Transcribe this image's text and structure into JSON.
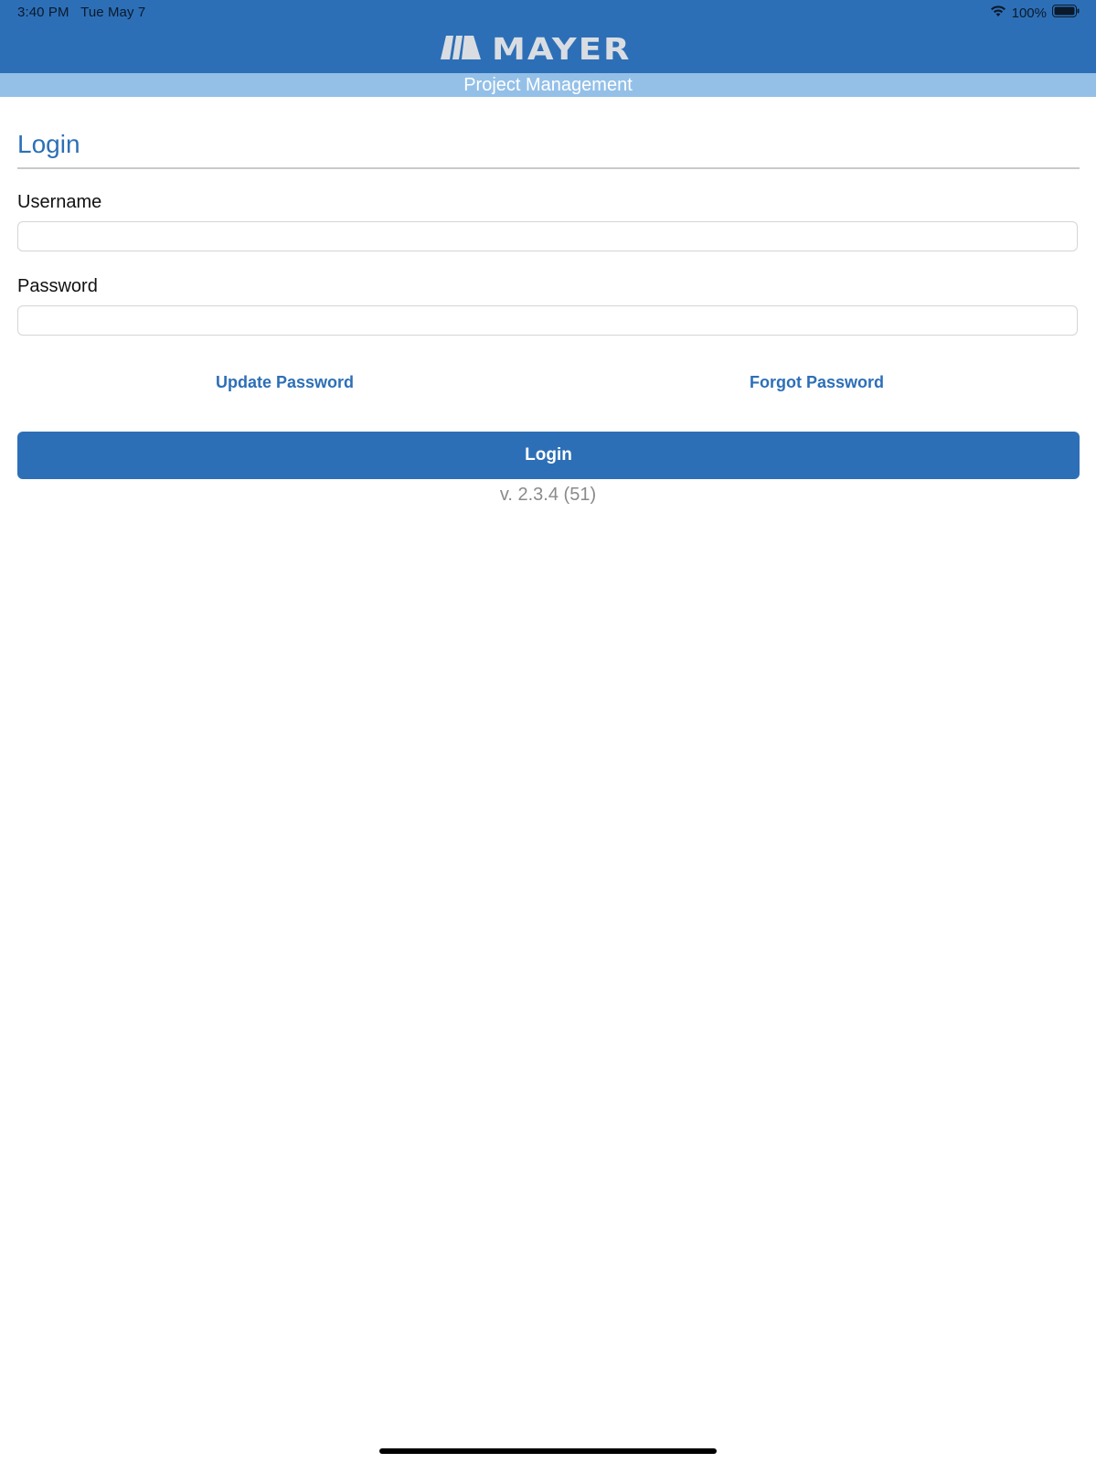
{
  "status_bar": {
    "time": "3:40 PM",
    "date": "Tue May 7",
    "battery": "100%",
    "icons": [
      "wifi-icon",
      "battery-icon"
    ]
  },
  "header": {
    "brand": "MAYER",
    "subtitle": "Project Management"
  },
  "login_form": {
    "title": "Login",
    "username_label": "Username",
    "username_value": "",
    "password_label": "Password",
    "password_value": "",
    "update_password_link": "Update Password",
    "forgot_password_link": "Forgot Password",
    "submit_label": "Login"
  },
  "version": "v. 2.3.4 (51)",
  "colors": {
    "primary": "#2d6fb7",
    "subheader": "#94c0e8",
    "version_text": "#8a8a8a"
  }
}
